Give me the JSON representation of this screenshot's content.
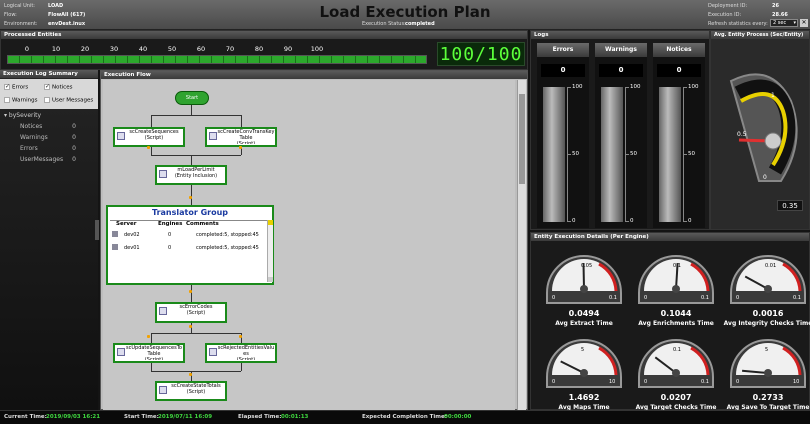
{
  "header": {
    "logical_unit_label": "Logical Unit:",
    "logical_unit": "LOAD",
    "flow_label": "Flow:",
    "flow": "FlowAll (617)",
    "environment_label": "Environment:",
    "environment": "envDest.inux",
    "title": "Load Execution Plan",
    "status_label": "Execution Status:",
    "status": "completed",
    "deployment_id_label": "Deployment ID:",
    "deployment_id": "26",
    "execution_id_label": "Execution ID:",
    "execution_id": "28.66",
    "refresh_label": "Refresh statistics every:",
    "refresh_value": "2 sec"
  },
  "progress": {
    "section_title": "Processed Entities",
    "ticks": [
      "0",
      "10",
      "20",
      "30",
      "40",
      "50",
      "60",
      "70",
      "80",
      "90",
      "100"
    ],
    "percent": 100,
    "digital": "100/100"
  },
  "log_summary": {
    "section_title": "Execution Log Summary",
    "checks": [
      {
        "label": "Errors",
        "checked": true
      },
      {
        "label": "Notices",
        "checked": true
      },
      {
        "label": "Warnings",
        "checked": false
      },
      {
        "label": "User Messages",
        "checked": false
      }
    ],
    "group_label": "bySeverity",
    "rows": [
      {
        "label": "Notices",
        "value": "0"
      },
      {
        "label": "Warnings",
        "value": "0"
      },
      {
        "label": "Errors",
        "value": "0"
      },
      {
        "label": "UserMessages",
        "value": "0"
      }
    ]
  },
  "flow": {
    "section_title": "Execution Flow",
    "start": "Start",
    "nodes": {
      "create_sequences": {
        "line1": "scCreateSequences",
        "line2": "(Script)"
      },
      "create_conv": {
        "line1": "scCreateConvTransKey",
        "line2": "Table",
        "line3": "(Script)"
      },
      "load_per_limit": {
        "line1": "mLoadPerLimit",
        "line2": "(Entity Inclusion)"
      },
      "error_codes": {
        "line1": "scErrorCodes",
        "line2": "(Script)"
      },
      "update_sequences": {
        "line1": "scUpdateSequencesTo",
        "line2": "Table",
        "line3": "(Script)"
      },
      "rejected": {
        "line1": "scRejectedEntitiesValu",
        "line2": "es",
        "line3": "(Script)"
      },
      "state_totals": {
        "line1": "scCreateStateTotals",
        "line2": "(Script)"
      }
    },
    "group": {
      "title": "Translator Group",
      "headers": [
        "Server",
        "Engines",
        "Comments"
      ],
      "rows": [
        {
          "server": "dev02",
          "engines": "0",
          "comments": "completed:5, stopped:45"
        },
        {
          "server": "dev01",
          "engines": "0",
          "comments": "completed:5, stopped:45"
        }
      ]
    }
  },
  "logs": {
    "section_title": "Logs",
    "columns": [
      {
        "label": "Errors",
        "value": "0"
      },
      {
        "label": "Warnings",
        "value": "0"
      },
      {
        "label": "Notices",
        "value": "0"
      }
    ],
    "scale": [
      "100",
      "50",
      "0"
    ]
  },
  "avg_entity": {
    "section_title": "Avg. Entity Process (Sec/Entity)",
    "value": "0.35",
    "dial_labels": [
      "1",
      "0.5",
      "0"
    ],
    "fraction": 0.35,
    "colors": {
      "needle": "#e03030",
      "zone_good": "#2fa32f",
      "zone_warn": "#e8d000",
      "zone_bad": "#d02020"
    }
  },
  "details": {
    "section_title": "Entity Execution Details (Per Engine)",
    "gauges": [
      {
        "value": "0.0494",
        "label": "Avg Extract Time",
        "min": "0",
        "mid": "0.05",
        "max": "0.1",
        "fraction": 0.494
      },
      {
        "value": "0.1044",
        "label": "Avg Enrichments Time",
        "min": "0",
        "mid": "0.1",
        "max": "0.1",
        "fraction": 0.52
      },
      {
        "value": "0.0016",
        "label": "Avg Integrity Checks Time",
        "min": "0",
        "mid": "0.01",
        "max": "0.1",
        "fraction": 0.16
      },
      {
        "value": "1.4692",
        "label": "Avg Maps Time",
        "min": "0",
        "mid": "5",
        "max": "10",
        "fraction": 0.147
      },
      {
        "value": "0.0207",
        "label": "Avg Target Checks Time",
        "min": "0",
        "mid": "0.1",
        "max": "0.1",
        "fraction": 0.207
      },
      {
        "value": "0.2733",
        "label": "Avg Save To Target Time",
        "min": "0",
        "mid": "5",
        "max": "10",
        "fraction": 0.027
      }
    ]
  },
  "footer": {
    "current_time_label": "Current Time:",
    "current_time": "2019/09/03 16:21",
    "start_time_label": "Start Time:",
    "start_time": "2019/07/11 16:09",
    "elapsed_label": "Elapsed Time:",
    "elapsed": "00:01:13",
    "expected_label": "Expected Completion Time:",
    "expected": "00:00:00"
  }
}
